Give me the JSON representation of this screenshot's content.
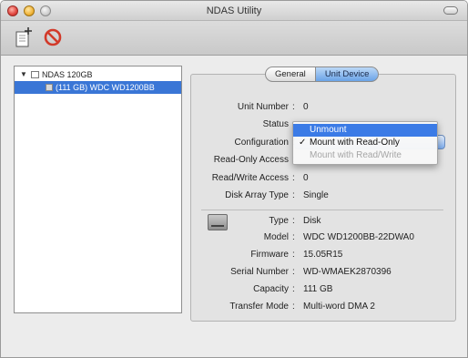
{
  "window": {
    "title": "NDAS Utility"
  },
  "toolbar": {
    "new_icon": "register-device-icon",
    "remove_icon": "unregister-device-icon"
  },
  "sidebar": {
    "root_label": "NDAS 120GB",
    "child_label": "(111 GB) WDC WD1200BB"
  },
  "tabs": [
    {
      "label": "General",
      "active": false
    },
    {
      "label": "Unit Device",
      "active": true
    }
  ],
  "unit": {
    "unit_number_label": "Unit Number",
    "unit_number_value": "0",
    "status_label": "Status",
    "configuration_label": "Configuration",
    "read_only_label": "Read-Only Access",
    "read_write_label": "Read/Write Access",
    "read_write_value": "0",
    "disk_array_label": "Disk Array Type",
    "disk_array_value": "Single"
  },
  "disk": {
    "icon": "hard-disk-icon",
    "type_label": "Type",
    "type_value": "Disk",
    "model_label": "Model",
    "model_value": "WDC WD1200BB-22DWA0",
    "firmware_label": "Firmware",
    "firmware_value": "15.05R15",
    "serial_label": "Serial Number",
    "serial_value": "WD-WMAEK2870396",
    "capacity_label": "Capacity",
    "capacity_value": "111 GB",
    "transfer_label": "Transfer Mode",
    "transfer_value": "Multi-word DMA 2"
  },
  "menu": {
    "items": [
      {
        "label": "Unmount",
        "highlighted": true,
        "checked": false,
        "enabled": true
      },
      {
        "label": "Mount with Read-Only",
        "highlighted": false,
        "checked": true,
        "enabled": true
      },
      {
        "label": "Mount with Read/Write",
        "highlighted": false,
        "checked": false,
        "enabled": false
      }
    ]
  },
  "colors": {
    "selection": "#3a76d6",
    "menu_highlight": "#3b7be6",
    "tab_active": "#6aa3e8"
  }
}
